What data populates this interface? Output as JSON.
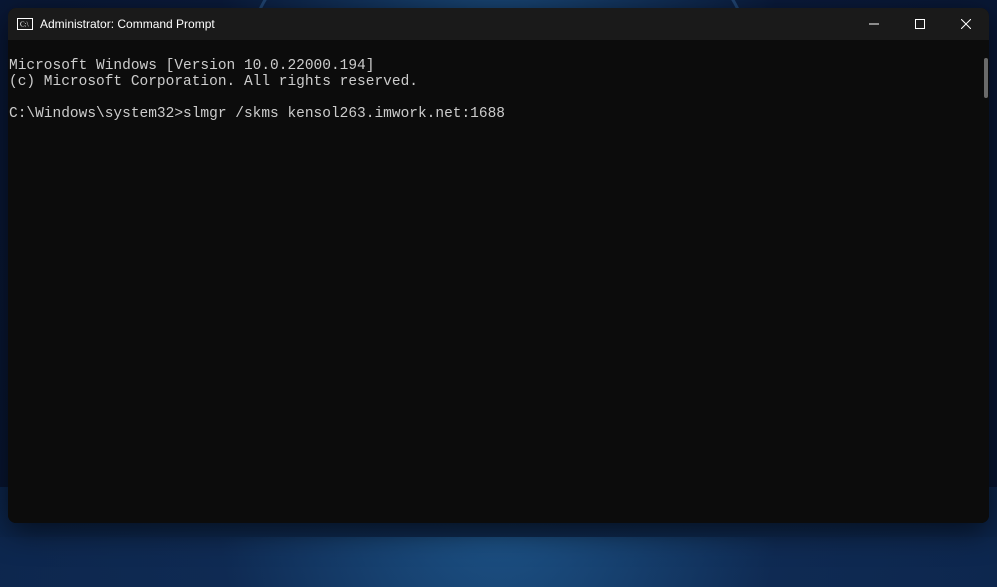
{
  "window": {
    "title": "Administrator: Command Prompt"
  },
  "terminal": {
    "banner_line1": "Microsoft Windows [Version 10.0.22000.194]",
    "banner_line2": "(c) Microsoft Corporation. All rights reserved.",
    "blank": "",
    "prompt": "C:\\Windows\\system32>",
    "command": "slmgr /skms kensol263.imwork.net:1688"
  }
}
